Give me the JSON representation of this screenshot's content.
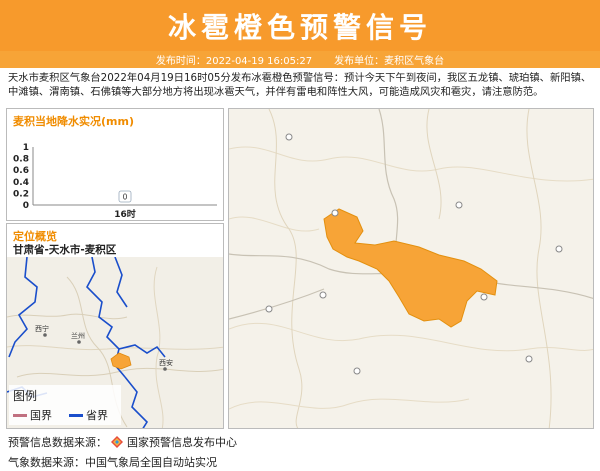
{
  "header": {
    "title": "冰雹橙色预警信号"
  },
  "meta": {
    "publish_time": "发布时间：2022-04-19 16:05:27",
    "publisher": "发布单位：麦积区气象台"
  },
  "description": "天水市麦积区气象台2022年04月19日16时05分发布冰雹橙色预警信号：预计今天下午到夜间，我区五龙镇、琥珀镇、新阳镇、中滩镇、渭南镇、石佛镇等大部分地方将出现冰雹天气，并伴有雷电和阵性大风，可能造成风灾和雹灾，请注意防范。",
  "chart_panel": {
    "title": "麦积当地降水实况(mm)"
  },
  "chart_data": {
    "type": "bar",
    "categories": [
      "16时"
    ],
    "values": [
      0
    ],
    "data_labels": [
      "0"
    ],
    "title": "麦积当地降水实况(mm)",
    "ylim": [
      0,
      1
    ],
    "yticks": [
      "0",
      "0.2",
      "0.4",
      "0.6",
      "0.8",
      "1"
    ],
    "grid": false
  },
  "location": {
    "title": "定位概览",
    "region": "甘肃省-天水市-麦积区",
    "city_labels": [
      "西宁",
      "兰州",
      "西安"
    ]
  },
  "legend": {
    "title": "图例",
    "items": [
      {
        "label": "国界",
        "color": "#c07080"
      },
      {
        "label": "省界",
        "color": "#1a4ecb"
      }
    ]
  },
  "footer": {
    "warning_source_label": "预警信息数据来源：",
    "warning_source": "国家预警信息发布中心",
    "weather_source": "气象数据来源：中国气象局全国自动站实况"
  },
  "colors": {
    "header": "#f79a2c",
    "warning_area": "#f7a437",
    "province_border": "#1a4ecb",
    "country_border": "#c07080"
  }
}
